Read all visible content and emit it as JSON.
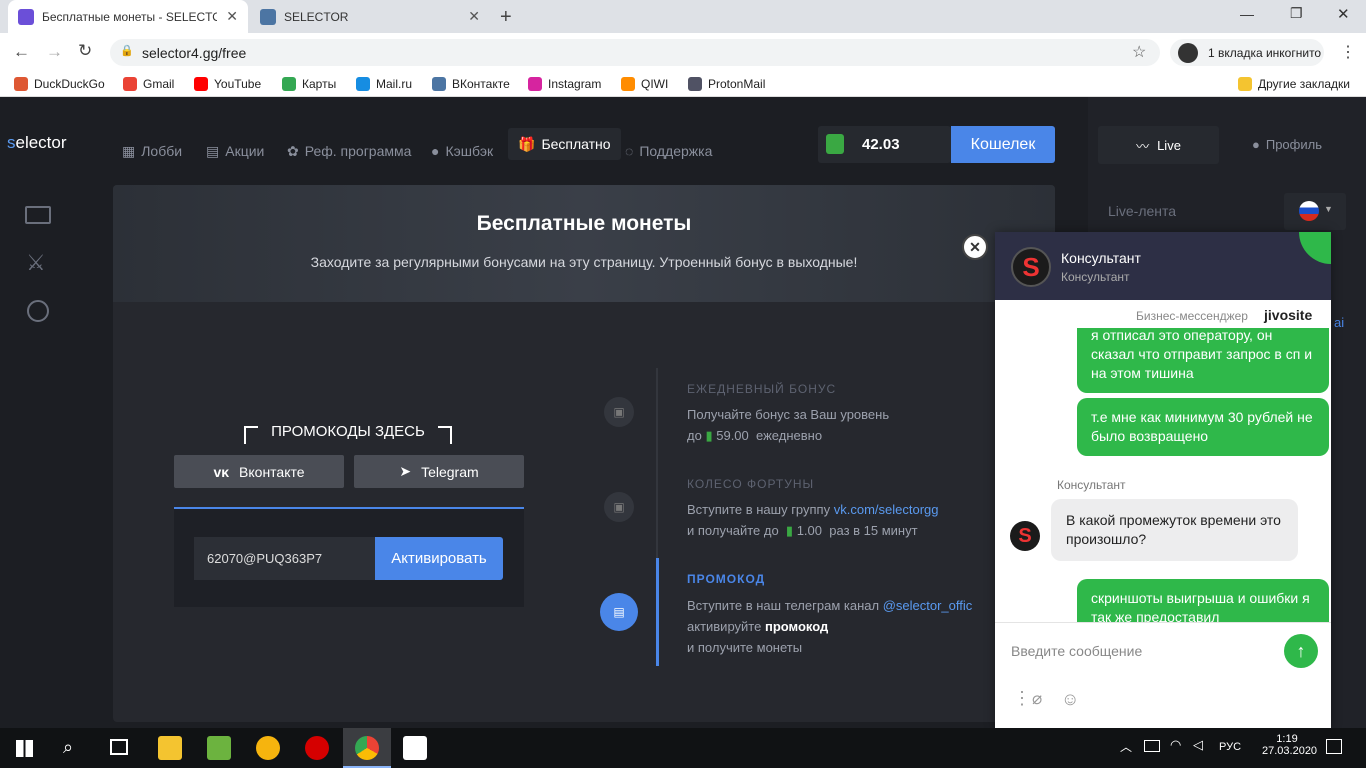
{
  "browser": {
    "tabs": [
      {
        "title": "Бесплатные монеты - SELECTOR",
        "active": true
      },
      {
        "title": "SELECTOR",
        "active": false
      }
    ],
    "url": "selector4.gg/free",
    "incognito_label": "1 вкладка инкогнито",
    "bookmarks": [
      "DuckDuckGo",
      "Gmail",
      "YouTube",
      "Карты",
      "Mail.ru",
      "ВКонтакте",
      "Instagram",
      "QIWI",
      "ProtonMail"
    ],
    "other_bookmarks": "Другие закладки"
  },
  "site": {
    "logo_s": "s",
    "logo_rest": "elector",
    "nav": [
      "Лобби",
      "Акции",
      "Реф. программа",
      "Кэшбэк",
      "Бесплатно",
      "Поддержка"
    ],
    "active_nav": "Бесплатно",
    "balance": "42.03",
    "wallet_label": "Кошелек",
    "live_label": "Live",
    "profile_label": "Профиль",
    "live_feed_label": "Live-лента",
    "feed_fragment": "ai"
  },
  "page": {
    "title": "Бесплатные монеты",
    "subtitle": "Заходите за регулярными бонусами на эту страницу. Утроенный бонус в выходные!",
    "promo_header": "ПРОМОКОДЫ ЗДЕСЬ",
    "vk_button": "Вконтакте",
    "telegram_button": "Telegram",
    "promo_input_value": "62070@PUQ363P7",
    "activate_label": "Активировать",
    "steps": [
      {
        "title": "ЕЖЕДНЕВНЫЙ БОНУС",
        "line1": "Получайте бонус за Ваш уровень",
        "line2_pre": "до",
        "amount": "59.00",
        "line2_post": "ежедневно"
      },
      {
        "title": "КОЛЕСО ФОРТУНЫ",
        "line1_pre": "Вступите в нашу группу",
        "link": "vk.com/selectorgg",
        "line2_pre": "и получайте до",
        "amount": "1.00",
        "line2_post": "раз в 15 минут"
      },
      {
        "title": "ПРОМОКОД",
        "line1_pre": "Вступите в наш телеграм канал",
        "link": "@selector_offic",
        "line2_pre": "активируйте",
        "line2_bold": "промокод",
        "line3": "и получите монеты"
      }
    ]
  },
  "chat": {
    "agent_name": "Консультант",
    "agent_role": "Консультант",
    "brand_label": "Бизнес-мессенджер",
    "brand_name": "jivosite",
    "messages": [
      {
        "from": "user",
        "text": "я отписал это оператору, он сказал что отправит запрос в сп и на этом тишина"
      },
      {
        "from": "user",
        "text": "т.е мне как минимум 30 рублей не было возвращено"
      },
      {
        "from": "agent",
        "name": "Консультант",
        "text": "В какой промежуток времени это произошло?"
      },
      {
        "from": "user",
        "text": "скриншоты выигрыша и ошибки я так же предоставил"
      }
    ],
    "input_placeholder": "Введите сообщение"
  },
  "taskbar": {
    "lang": "РУС",
    "time": "1:19",
    "date": "27.03.2020"
  },
  "colors": {
    "accent": "#4a86e8",
    "chat_green": "#2fb84a",
    "chat_header": "#2d2f45"
  }
}
